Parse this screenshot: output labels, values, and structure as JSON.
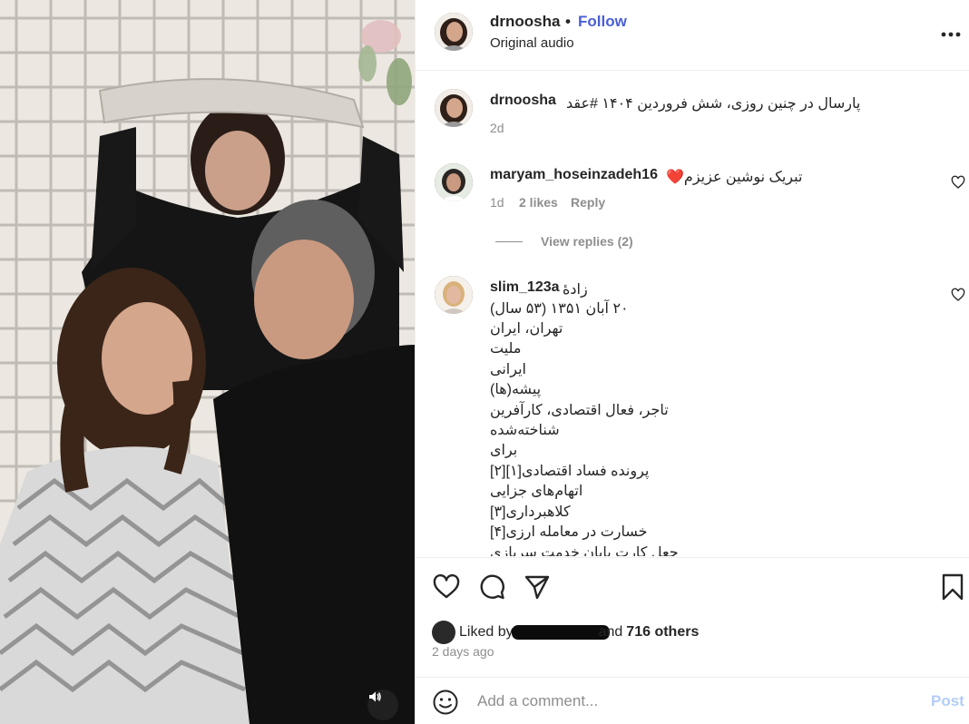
{
  "post": {
    "username": "drnoosha",
    "separator": "•",
    "follow_label": "Follow",
    "subtitle": "Original audio"
  },
  "caption": {
    "username": "drnoosha",
    "text": "پارسال در چنین روزی، شش فروردین ۱۴۰۴ #عقد",
    "time": "2d"
  },
  "comments": [
    {
      "username": "maryam_hoseinzadeh16",
      "text": "تبریک نوشین عزیزم❤️",
      "time": "1d",
      "likes": "2 likes",
      "reply_label": "Reply",
      "view_replies": "View replies (2)"
    },
    {
      "username": "slim_123a",
      "lines": [
        "زادهٔ",
        "۲۰ آبان ۱۳۵۱ (۵۳ سال)",
        "تهران، ایران",
        "ملیت",
        "ایرانی",
        "پیشه(ها)",
        "تاجر، فعال اقتصادی، کارآفرین",
        "شناخته‌شده",
        "برای",
        "پرونده فساد اقتصادی[۱][۲]",
        "اتهام‌های جزایی",
        "کلاهبرداری[۳]",
        "خسارت در معامله ارزی[۴]",
        "جعل کارت پایان خدمت سربازی"
      ]
    }
  ],
  "likes": {
    "prefix": "Liked by",
    "suffix": "and",
    "count": "716 others"
  },
  "timestamp": "2 days ago",
  "add_comment": {
    "placeholder": "Add a comment...",
    "post_label": "Post"
  },
  "icons": {
    "more": "more-options-icon",
    "like": "heart-icon",
    "comment": "comment-icon",
    "share": "share-icon",
    "save": "bookmark-icon",
    "emoji": "emoji-icon",
    "audio": "speaker-icon"
  },
  "colors": {
    "follow": "#4a5fd6",
    "post_disabled": "#b3cdf7",
    "muted": "#8e8e8e",
    "text": "#262626"
  }
}
